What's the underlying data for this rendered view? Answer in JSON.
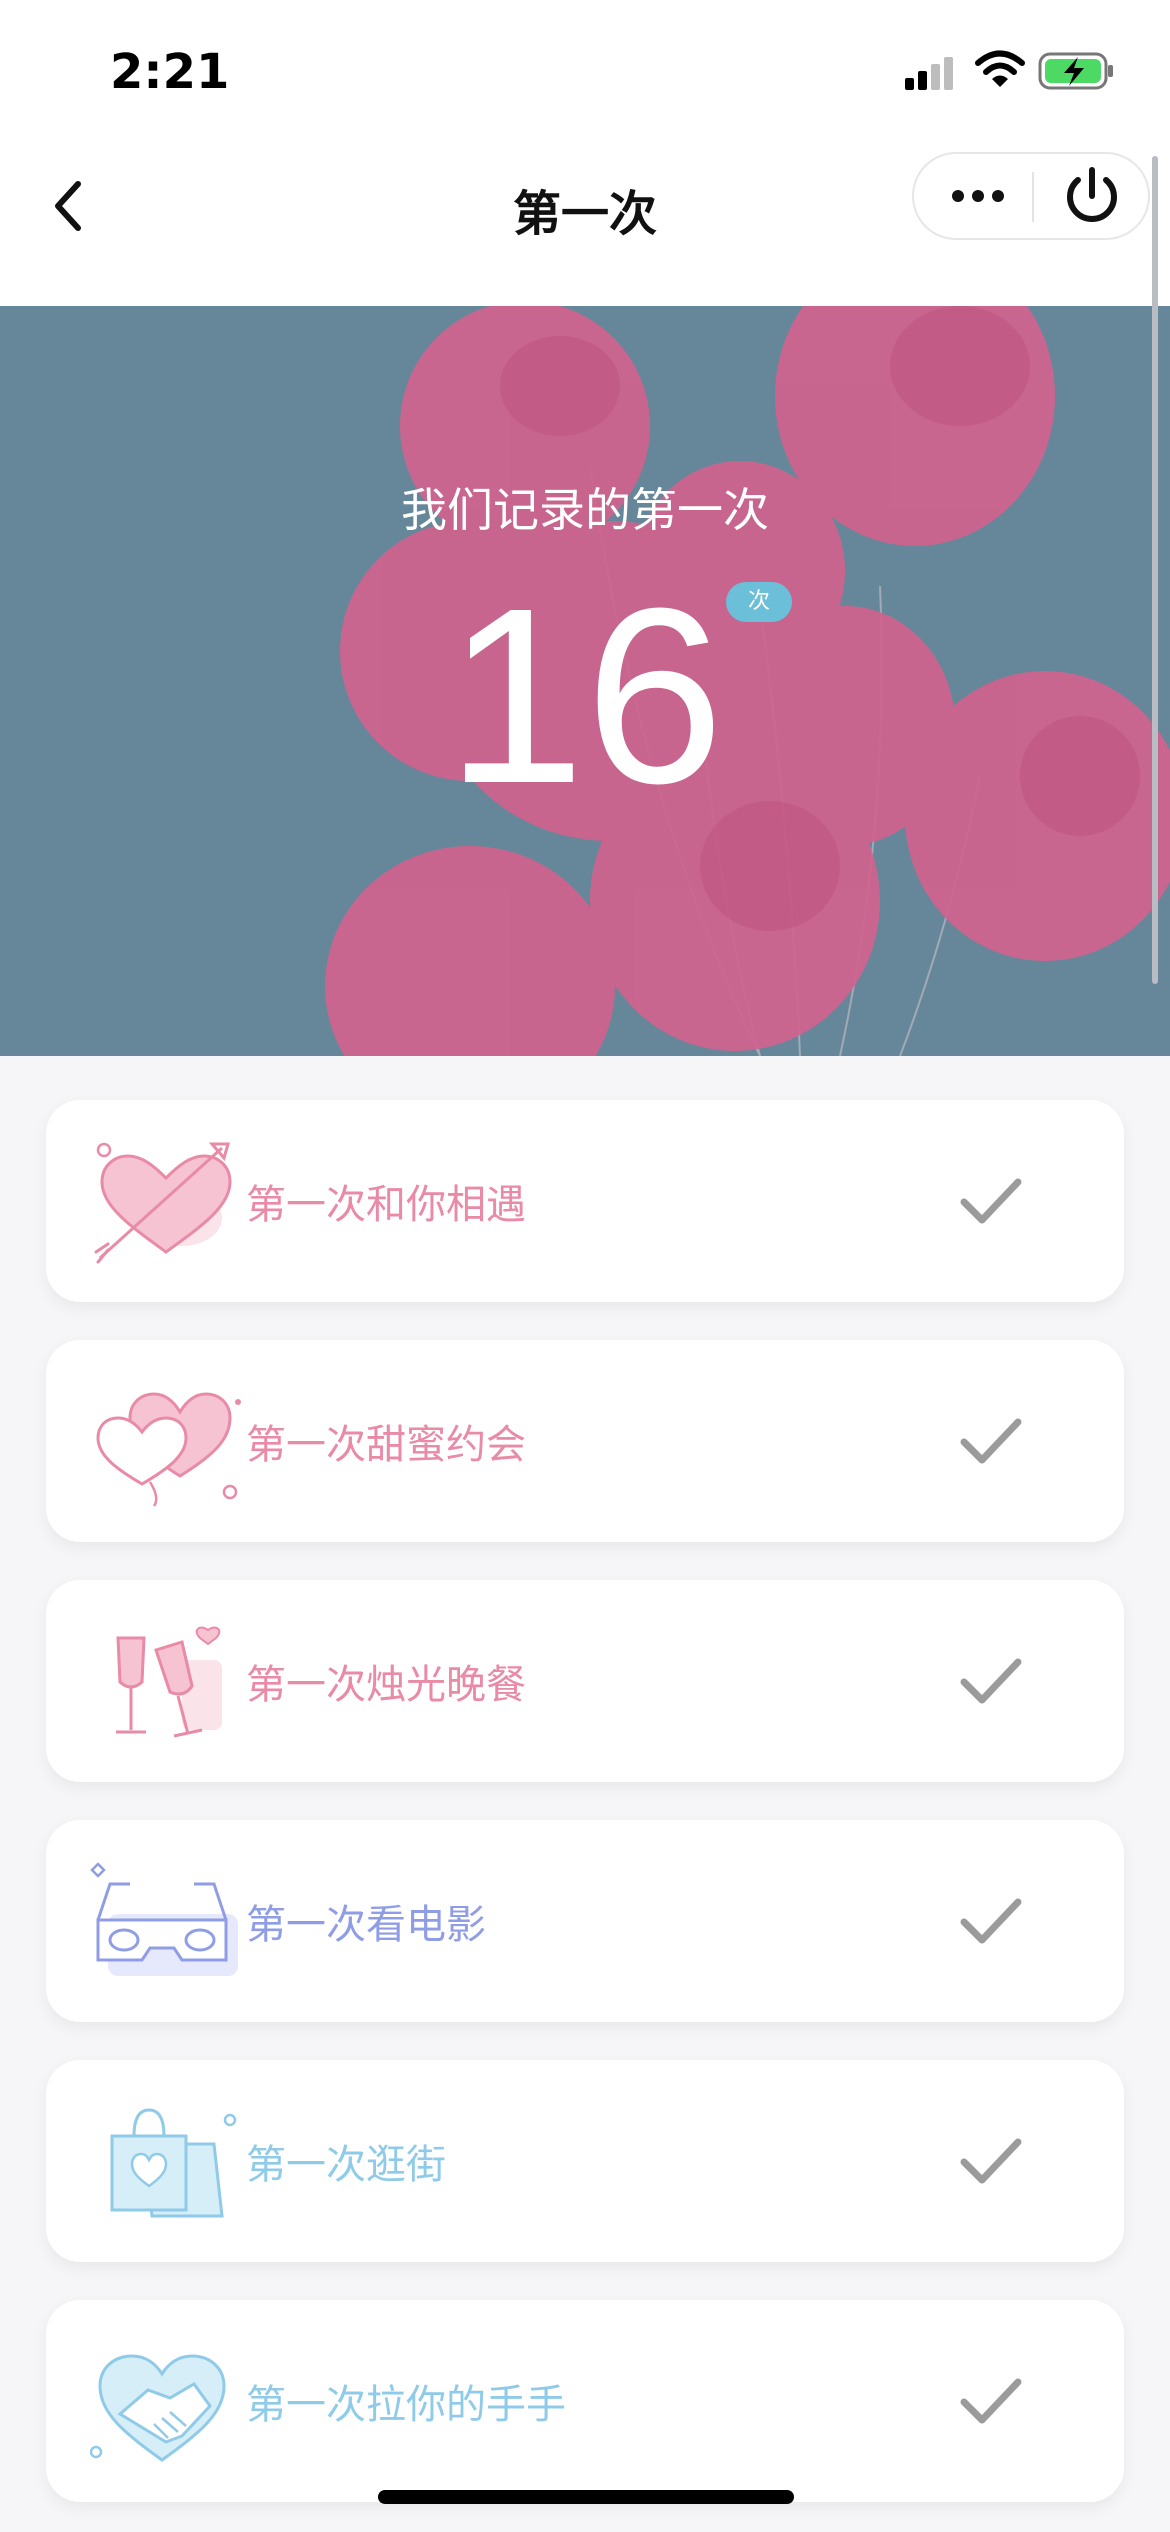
{
  "status_bar": {
    "time": "2:21"
  },
  "nav": {
    "title": "第一次"
  },
  "hero": {
    "title": "我们记录的第一次",
    "count": "16",
    "count_unit": "次"
  },
  "items": [
    {
      "label": "第一次和你相遇",
      "icon": "heart-arrow-icon",
      "color": "#e98aa7"
    },
    {
      "label": "第一次甜蜜约会",
      "icon": "hearts-balloon-icon",
      "color": "#e98aa7"
    },
    {
      "label": "第一次烛光晚餐",
      "icon": "champagne-glasses-icon",
      "color": "#e98aa7"
    },
    {
      "label": "第一次看电影",
      "icon": "3d-glasses-icon",
      "color": "#8f9de6"
    },
    {
      "label": "第一次逛街",
      "icon": "shopping-bag-icon",
      "color": "#8fcbe8"
    },
    {
      "label": "第一次拉你的手手",
      "icon": "handshake-heart-icon",
      "color": "#8fcbe8"
    }
  ],
  "colors": {
    "hero_bg": "#66879a",
    "balloon": "#d0638e",
    "badge": "#6bbfd9",
    "check": "#9b9b9b"
  }
}
